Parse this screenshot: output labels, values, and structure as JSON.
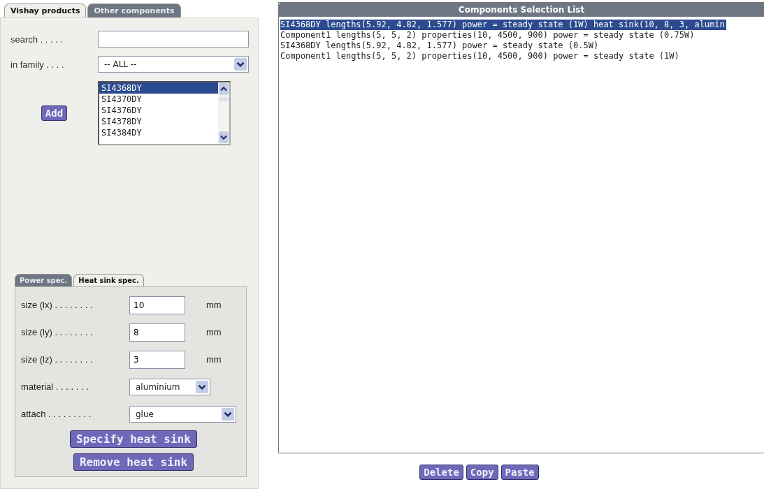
{
  "tabs": [
    {
      "label": "Vishay products",
      "selected": true
    },
    {
      "label": "Other components",
      "selected": false
    }
  ],
  "search": {
    "label": "search . . . . ."
  },
  "family": {
    "label": "in family . . . .",
    "value": "-- ALL --"
  },
  "add_button": "Add",
  "parts": [
    {
      "label": "SI4368DY",
      "selected": true
    },
    {
      "label": "SI4370DY",
      "selected": false
    },
    {
      "label": "SI4376DY",
      "selected": false
    },
    {
      "label": "SI4378DY",
      "selected": false
    },
    {
      "label": "SI4384DY",
      "selected": false
    }
  ],
  "spec_tabs": [
    {
      "label": "Power spec.",
      "selected": false
    },
    {
      "label": "Heat sink spec.",
      "selected": true
    }
  ],
  "fields": [
    {
      "kind": "input",
      "label": "size (lx) . . . . . . . .",
      "value": "10",
      "unit": "mm"
    },
    {
      "kind": "input",
      "label": "size (ly) . . . . . . . .",
      "value": "8",
      "unit": "mm"
    },
    {
      "kind": "input",
      "label": "size (lz) . . . . . . . .",
      "value": "3",
      "unit": "mm"
    },
    {
      "kind": "select",
      "label": "material . . . . . . .",
      "value": "aluminium"
    },
    {
      "kind": "select-wide",
      "label": "attach . . . . . . . . .",
      "value": "glue"
    }
  ],
  "spec_buttons": [
    "Specify heat sink",
    "Remove heat sink"
  ],
  "list": {
    "title": "Components Selection List",
    "rows": [
      {
        "text": "SI4368DY lengths(5.92, 4.82, 1.577) power = steady state (1W) heat sink(10, 8, 3, alumin",
        "selected": true
      },
      {
        "text": "Component1 lengths(5, 5, 2) properties(10, 4500, 900) power = steady state (0.75W)",
        "selected": false
      },
      {
        "text": "SI4368DY lengths(5.92, 4.82, 1.577) power = steady state (0.5W)",
        "selected": false
      },
      {
        "text": "Component1 lengths(5, 5, 2) properties(10, 4500, 900) power = steady state (1W)",
        "selected": false
      }
    ]
  },
  "list_buttons": [
    "Delete",
    "Copy",
    "Paste"
  ]
}
